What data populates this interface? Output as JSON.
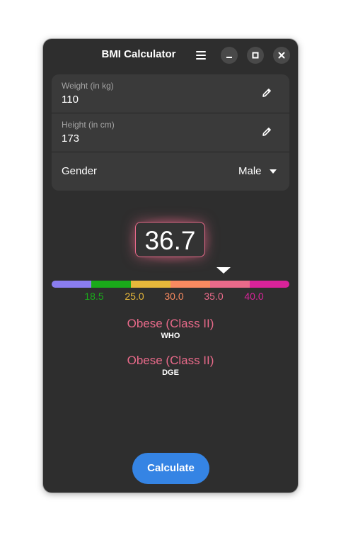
{
  "window": {
    "title": "BMI Calculator"
  },
  "form": {
    "weight": {
      "label": "Weight (in kg)",
      "value": "110"
    },
    "height": {
      "label": "Height (in cm)",
      "value": "173"
    },
    "gender": {
      "label": "Gender",
      "value": "Male"
    }
  },
  "result": {
    "bmi": "36.7",
    "scale": {
      "segment_colors": [
        "#8a7df0",
        "#1aaa1a",
        "#e7b83a",
        "#f98a60",
        "#e96a8a",
        "#d8239a"
      ],
      "ticks": [
        {
          "label": "18.5",
          "color": "#1aaa1a"
        },
        {
          "label": "25.0",
          "color": "#e7b83a"
        },
        {
          "label": "30.0",
          "color": "#f98a60"
        },
        {
          "label": "35.0",
          "color": "#e96a8a"
        },
        {
          "label": "40.0",
          "color": "#d8239a"
        }
      ]
    },
    "classifications": [
      {
        "name": "Obese (Class II)",
        "standard": "WHO"
      },
      {
        "name": "Obese (Class II)",
        "standard": "DGE"
      }
    ]
  },
  "actions": {
    "calculate_label": "Calculate",
    "accent_color": "#3584e4"
  },
  "icons": {
    "menu": "hamburger-menu-icon",
    "minimize": "minimize-icon",
    "maximize": "maximize-icon",
    "close": "close-icon",
    "edit": "pencil-icon",
    "dropdown": "chevron-down-icon",
    "marker": "triangle-marker-icon"
  }
}
